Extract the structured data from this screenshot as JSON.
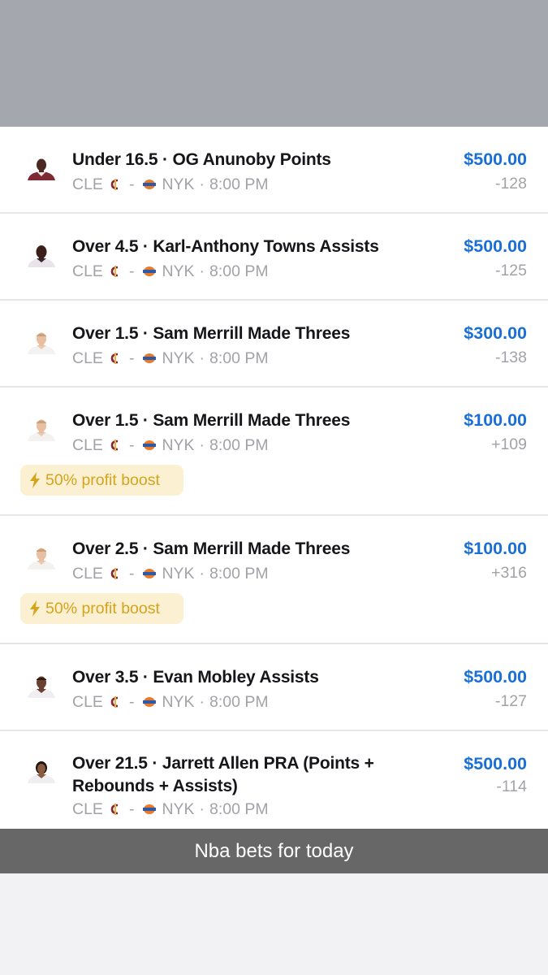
{
  "caption": "Nba bets for today",
  "game": {
    "away": "CLE",
    "home": "NYK",
    "time": "8:00 PM",
    "dash": "-",
    "separator": "·"
  },
  "boost_label": "50% profit boost",
  "colors": {
    "amount": "#1a6fd6",
    "boost_text": "#d4a41b",
    "boost_bg": "#fcf0d2",
    "muted": "#a2a2a8"
  },
  "bets": [
    {
      "title": "Under 16.5 · OG Anunoby Points",
      "amount": "$500.00",
      "odds": "-128",
      "avatar_icon": "player-headshot-icon"
    },
    {
      "title": "Over 4.5 · Karl-Anthony Towns Assists",
      "amount": "$500.00",
      "odds": "-125",
      "avatar_icon": "player-headshot-icon"
    },
    {
      "title": "Over 1.5 · Sam Merrill Made Threes",
      "amount": "$300.00",
      "odds": "-138",
      "avatar_icon": "player-headshot-icon"
    },
    {
      "title": "Over 1.5 · Sam Merrill Made Threes",
      "amount": "$100.00",
      "odds": "+109",
      "boost": true,
      "avatar_icon": "player-headshot-icon"
    },
    {
      "title": "Over 2.5 · Sam Merrill Made Threes",
      "amount": "$100.00",
      "odds": "+316",
      "boost": true,
      "avatar_icon": "player-headshot-icon"
    },
    {
      "title": "Over 3.5 · Evan Mobley Assists",
      "amount": "$500.00",
      "odds": "-127",
      "avatar_icon": "player-headshot-icon"
    },
    {
      "title": "Over 21.5 · Jarrett Allen PRA (Points + Rebounds + Assists)",
      "amount": "$500.00",
      "odds": "-114",
      "avatar_icon": "player-headshot-icon"
    }
  ]
}
